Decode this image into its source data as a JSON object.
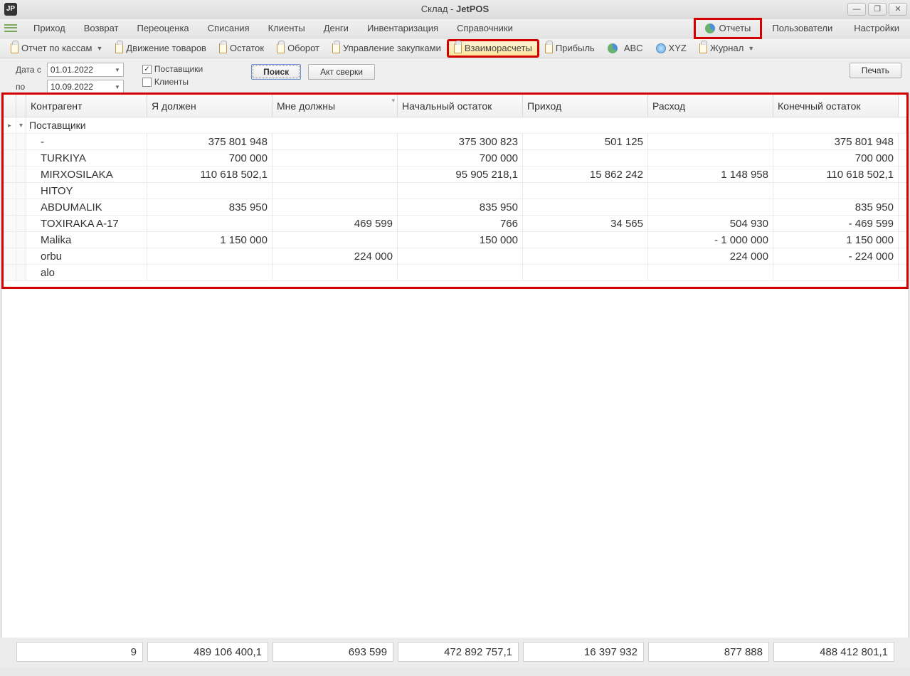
{
  "window": {
    "title_pre": "Склад - ",
    "title_app": "JetPOS"
  },
  "menu": {
    "items": [
      "Приход",
      "Возврат",
      "Переоценка",
      "Списания",
      "Клиенты",
      "Денги",
      "Инвентаризация",
      "Справочники"
    ],
    "right": {
      "reports": "Отчеты",
      "users": "Пользователи",
      "settings": "Настройки"
    }
  },
  "toolbar": {
    "items": [
      {
        "label": "Отчет по кассам",
        "dd": true
      },
      {
        "label": "Движение товаров"
      },
      {
        "label": "Остаток"
      },
      {
        "label": "Оборот"
      },
      {
        "label": "Управление закупками"
      },
      {
        "label": "Взаиморасчеты",
        "active": true
      },
      {
        "label": "Прибыль"
      },
      {
        "label": "ABC",
        "icon": "pie"
      },
      {
        "label": "XYZ",
        "icon": "globe"
      },
      {
        "label": "Журнал",
        "dd": true
      }
    ]
  },
  "filters": {
    "date_from_label": "Дата с",
    "date_from": "01.01.2022",
    "date_to_label": "по",
    "date_to": "10.09.2022",
    "suppliers_label": "Поставщики",
    "suppliers_checked": true,
    "clients_label": "Клиенты",
    "clients_checked": false,
    "search": "Поиск",
    "act": "Акт сверки",
    "print": "Печать"
  },
  "table": {
    "headers": [
      "Контрагент",
      "Я должен",
      "Мне должны",
      "Начальный остаток",
      "Приход",
      "Расход",
      "Конечный остаток"
    ],
    "group_label": "Поставщики",
    "rows": [
      {
        "c0": "-",
        "c1": "375 801 948",
        "c2": "",
        "c3": "375 300 823",
        "c4": "501 125",
        "c5": "",
        "c6": "375 801 948"
      },
      {
        "c0": "TURKIYA",
        "c1": "700 000",
        "c2": "",
        "c3": "700 000",
        "c4": "",
        "c5": "",
        "c6": "700 000"
      },
      {
        "c0": "MIRXOSILAKA",
        "c1": "110 618 502,1",
        "c2": "",
        "c3": "95 905 218,1",
        "c4": "15 862 242",
        "c5": "1 148 958",
        "c6": "110 618 502,1"
      },
      {
        "c0": "HITOY",
        "c1": "",
        "c2": "",
        "c3": "",
        "c4": "",
        "c5": "",
        "c6": ""
      },
      {
        "c0": "ABDUMALIK",
        "c1": "835 950",
        "c2": "",
        "c3": "835 950",
        "c4": "",
        "c5": "",
        "c6": "835 950"
      },
      {
        "c0": "TOXIRAKA A-17",
        "c1": "",
        "c2": "469 599",
        "c3": "766",
        "c4": "34 565",
        "c5": "504 930",
        "c6": "-  469 599"
      },
      {
        "c0": "Malika",
        "c1": "1 150 000",
        "c2": "",
        "c3": "150 000",
        "c4": "",
        "c5": "- 1 000 000",
        "c6": "1 150 000"
      },
      {
        "c0": "orbu",
        "c1": "",
        "c2": "224 000",
        "c3": "",
        "c4": "",
        "c5": "224 000",
        "c6": "-  224 000"
      },
      {
        "c0": "alo",
        "c1": "",
        "c2": "",
        "c3": "",
        "c4": "",
        "c5": "",
        "c6": ""
      }
    ]
  },
  "footer": {
    "count": "9",
    "totals": [
      "489 106 400,1",
      "693 599",
      "472 892 757,1",
      "16 397 932",
      "877 888",
      "488 412 801,1"
    ]
  }
}
